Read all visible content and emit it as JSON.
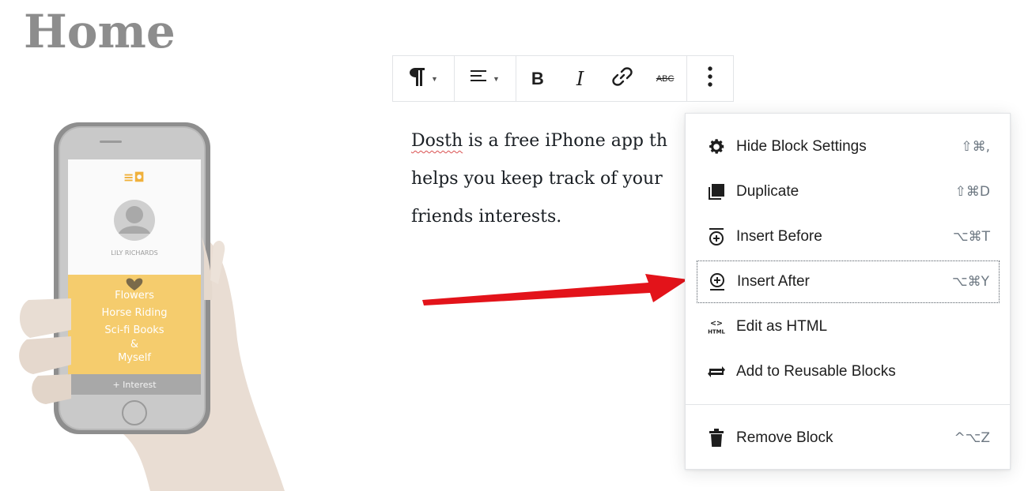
{
  "page": {
    "title": "Home"
  },
  "phone": {
    "user_name": "LILY RICHARDS",
    "interests": [
      "Flowers",
      "Horse Riding",
      "Sci-fi Books",
      "&",
      "Myself"
    ],
    "add_interest": "+ Interest"
  },
  "paragraph": {
    "word1": "Dosth",
    "rest1": " is a free iPhone app th",
    "line2": "helps you keep track of your",
    "line3": "friends interests."
  },
  "toolbar": {
    "items": [
      "paragraph-icon",
      "align-icon",
      "bold-icon",
      "italic-icon",
      "link-icon",
      "strikethrough-icon",
      "more-options-icon"
    ],
    "bold_label": "B",
    "italic_label": "I",
    "strikethrough_label": "ABC"
  },
  "menu": {
    "items": [
      {
        "label": "Hide Block Settings",
        "shortcut": "⇧⌘,",
        "icon": "gear-icon"
      },
      {
        "label": "Duplicate",
        "shortcut": "⇧⌘D",
        "icon": "duplicate-icon"
      },
      {
        "label": "Insert Before",
        "shortcut": "⌥⌘T",
        "icon": "insert-before-icon"
      },
      {
        "label": "Insert After",
        "shortcut": "⌥⌘Y",
        "icon": "insert-after-icon",
        "focused": true
      },
      {
        "label": "Edit as HTML",
        "shortcut": "",
        "icon": "html-icon"
      },
      {
        "label": "Add to Reusable Blocks",
        "shortcut": "",
        "icon": "reusable-block-icon"
      },
      {
        "label": "Remove Block",
        "shortcut": "^⌥Z",
        "icon": "trash-icon"
      }
    ],
    "html_icon_text": "HTML"
  },
  "colors": {
    "arrow": "#e3131a",
    "title": "#8d8d8d",
    "app_accent": "#f5cc6d"
  }
}
